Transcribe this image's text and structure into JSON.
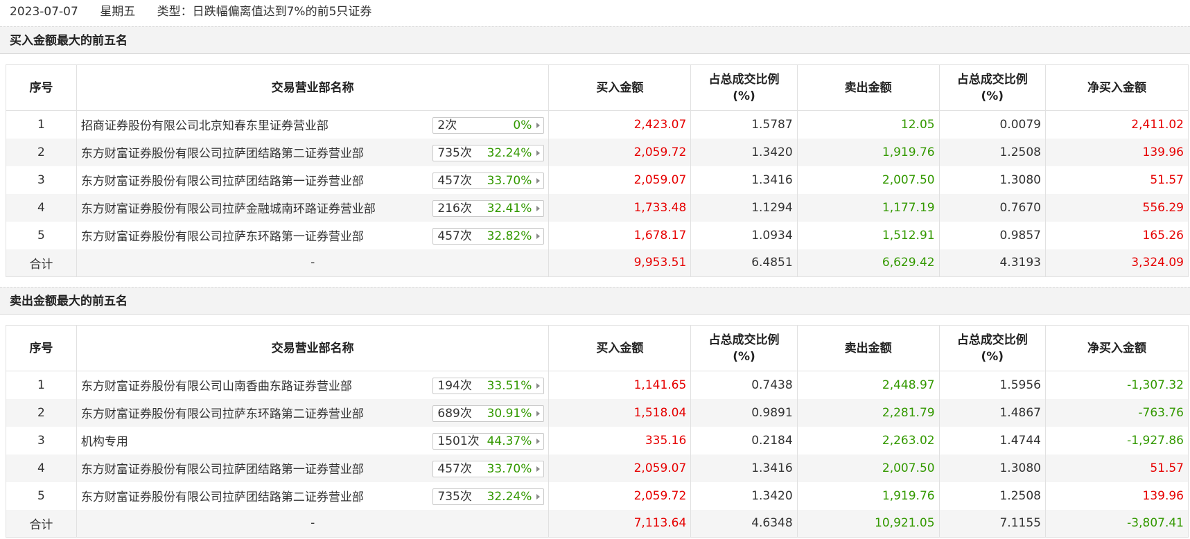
{
  "header": {
    "date": "2023-07-07",
    "weekday": "星期五",
    "type_label": "类型：日跌幅偏离值达到7%的前5只证券"
  },
  "columns": {
    "idx": "序号",
    "name": "交易营业部名称",
    "buy": "买入金额",
    "buy_ratio": "占总成交比例\n(%)",
    "sell": "卖出金额",
    "sell_ratio": "占总成交比例\n(%)",
    "net": "净买入金额"
  },
  "colors": {
    "positive": "#e60000",
    "negative": "#339900",
    "section_bg": "#f3f3f3"
  },
  "buy_top5": {
    "title": "买入金额最大的前五名",
    "rows": [
      {
        "idx": "1",
        "name": "招商证券股份有限公司北京知春东里证券营业部",
        "count": "2次",
        "rate": "0%",
        "buy": "2,423.07",
        "buy_ratio": "1.5787",
        "sell": "12.05",
        "sell_ratio": "0.0079",
        "net": "2,411.02",
        "net_sign": "pos"
      },
      {
        "idx": "2",
        "name": "东方财富证券股份有限公司拉萨团结路第二证券营业部",
        "count": "735次",
        "rate": "32.24%",
        "buy": "2,059.72",
        "buy_ratio": "1.3420",
        "sell": "1,919.76",
        "sell_ratio": "1.2508",
        "net": "139.96",
        "net_sign": "pos"
      },
      {
        "idx": "3",
        "name": "东方财富证券股份有限公司拉萨团结路第一证券营业部",
        "count": "457次",
        "rate": "33.70%",
        "buy": "2,059.07",
        "buy_ratio": "1.3416",
        "sell": "2,007.50",
        "sell_ratio": "1.3080",
        "net": "51.57",
        "net_sign": "pos"
      },
      {
        "idx": "4",
        "name": "东方财富证券股份有限公司拉萨金融城南环路证券营业部",
        "count": "216次",
        "rate": "32.41%",
        "buy": "1,733.48",
        "buy_ratio": "1.1294",
        "sell": "1,177.19",
        "sell_ratio": "0.7670",
        "net": "556.29",
        "net_sign": "pos"
      },
      {
        "idx": "5",
        "name": "东方财富证券股份有限公司拉萨东环路第一证券营业部",
        "count": "457次",
        "rate": "32.82%",
        "buy": "1,678.17",
        "buy_ratio": "1.0934",
        "sell": "1,512.91",
        "sell_ratio": "0.9857",
        "net": "165.26",
        "net_sign": "pos"
      }
    ],
    "total": {
      "label": "合计",
      "name": "-",
      "buy": "9,953.51",
      "buy_ratio": "6.4851",
      "sell": "6,629.42",
      "sell_ratio": "4.3193",
      "net": "3,324.09",
      "net_sign": "pos"
    }
  },
  "sell_top5": {
    "title": "卖出金额最大的前五名",
    "rows": [
      {
        "idx": "1",
        "name": "东方财富证券股份有限公司山南香曲东路证券营业部",
        "count": "194次",
        "rate": "33.51%",
        "buy": "1,141.65",
        "buy_ratio": "0.7438",
        "sell": "2,448.97",
        "sell_ratio": "1.5956",
        "net": "-1,307.32",
        "net_sign": "neg"
      },
      {
        "idx": "2",
        "name": "东方财富证券股份有限公司拉萨东环路第二证券营业部",
        "count": "689次",
        "rate": "30.91%",
        "buy": "1,518.04",
        "buy_ratio": "0.9891",
        "sell": "2,281.79",
        "sell_ratio": "1.4867",
        "net": "-763.76",
        "net_sign": "neg"
      },
      {
        "idx": "3",
        "name": "机构专用",
        "count": "1501次",
        "rate": "44.37%",
        "buy": "335.16",
        "buy_ratio": "0.2184",
        "sell": "2,263.02",
        "sell_ratio": "1.4744",
        "net": "-1,927.86",
        "net_sign": "neg"
      },
      {
        "idx": "4",
        "name": "东方财富证券股份有限公司拉萨团结路第一证券营业部",
        "count": "457次",
        "rate": "33.70%",
        "buy": "2,059.07",
        "buy_ratio": "1.3416",
        "sell": "2,007.50",
        "sell_ratio": "1.3080",
        "net": "51.57",
        "net_sign": "pos"
      },
      {
        "idx": "5",
        "name": "东方财富证券股份有限公司拉萨团结路第二证券营业部",
        "count": "735次",
        "rate": "32.24%",
        "buy": "2,059.72",
        "buy_ratio": "1.3420",
        "sell": "1,919.76",
        "sell_ratio": "1.2508",
        "net": "139.96",
        "net_sign": "pos"
      }
    ],
    "total": {
      "label": "合计",
      "name": "-",
      "buy": "7,113.64",
      "buy_ratio": "4.6348",
      "sell": "10,921.05",
      "sell_ratio": "7.1155",
      "net": "-3,807.41",
      "net_sign": "neg"
    }
  }
}
